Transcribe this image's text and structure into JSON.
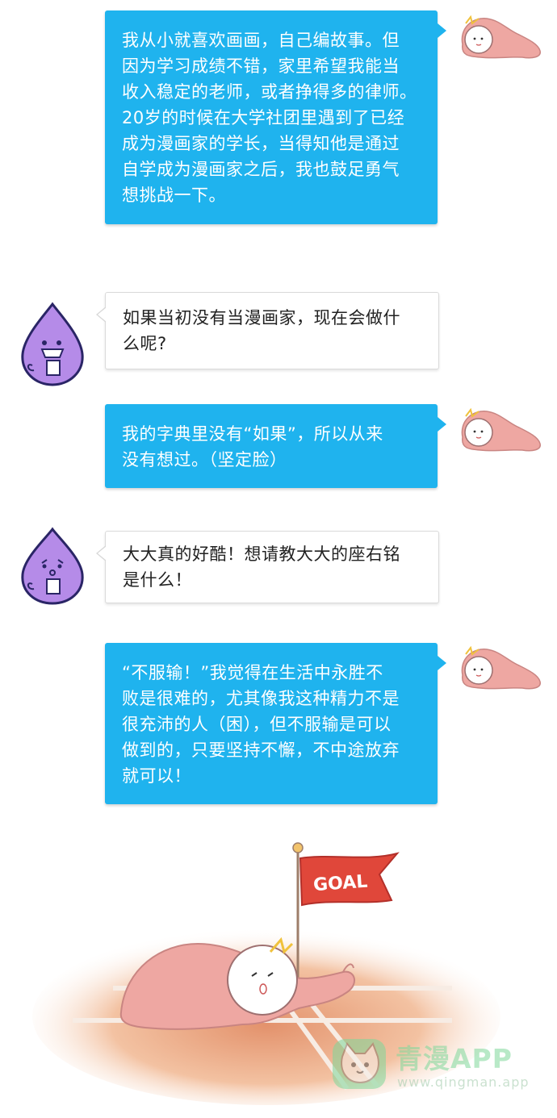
{
  "messages": [
    {
      "side": "right",
      "text": "我从小就喜欢画画，自己编故事。但\n因为学习成绩不错，家里希望我能当\n收入稳定的老师，或者挣得多的律师。\n20岁的时候在大学社团里遇到了已经\n成为漫画家的学长，当得知他是通过\n自学成为漫画家之后，我也鼓足勇气\n想挑战一下。"
    },
    {
      "side": "left",
      "text": "如果当初没有当漫画家，现在会做什\n么呢?"
    },
    {
      "side": "right",
      "text": "我的字典里没有“如果”，所以从来\n没有想过。（坚定脸）"
    },
    {
      "side": "left",
      "text": "大大真的好酷！想请教大大的座右铭\n是什么！"
    },
    {
      "side": "right",
      "text": "“不服输！”我觉得在生活中永胜不\n败是很难的，尤其像我这种精力不是\n很充沛的人（困），但不服输是可以\n做到的，只要坚持不懈，不中途放弃\n就可以！"
    }
  ],
  "illustration": {
    "flag_text": "GOAL"
  },
  "watermark": {
    "brand": "青漫APP",
    "url": "www.qingman.app"
  },
  "colors": {
    "bubble_blue": "#1fb3ee",
    "author_pink": "#e99a9a",
    "interviewer_purple": "#b58be8",
    "flag_red": "#e0473a",
    "watermark_green": "#7fd89b"
  }
}
